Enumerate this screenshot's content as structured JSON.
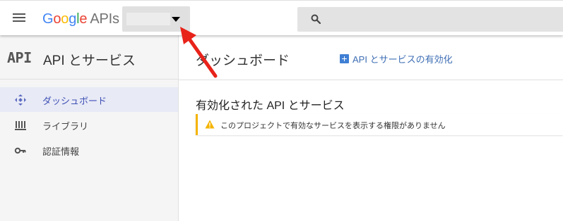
{
  "header": {
    "logo": {
      "letters": [
        "G",
        "o",
        "o",
        "g",
        "l",
        "e"
      ],
      "suffix": "APIs"
    },
    "brand_colors": [
      "#4285f4",
      "#ea4335",
      "#fbbc05",
      "#4285f4",
      "#34a853",
      "#ea4335"
    ],
    "menu_icon": "hamburger-menu-icon",
    "project_selector": {
      "selected_value": "",
      "caret_icon": "caret-down-icon"
    },
    "search": {
      "value": "",
      "placeholder": "",
      "icon": "search-icon"
    }
  },
  "sidebar": {
    "logo_text": "API",
    "title": "API とサービス",
    "items": [
      {
        "label": "ダッシュボード",
        "icon": "dashboard-icon",
        "active": true
      },
      {
        "label": "ライブラリ",
        "icon": "library-icon",
        "active": false
      },
      {
        "label": "認証情報",
        "icon": "key-icon",
        "active": false
      }
    ]
  },
  "main": {
    "title": "ダッシュボード",
    "enable_link": {
      "label": "API とサービスの有効化",
      "icon": "plus-box-icon"
    },
    "section_title": "有効化された API とサービス",
    "warning": {
      "icon": "warning-icon",
      "text": "このプロジェクトで有効なサービスを表示する権限がありません"
    }
  },
  "annotation": {
    "icon": "red-arrow-icon"
  },
  "colors": {
    "accent": "#3f51b5",
    "link": "#3f6fb5",
    "warning": "#f4b400",
    "sidebar_bg": "#f5f5f5",
    "active_bg": "#e8eaf6",
    "annotation_red": "#e8231a"
  }
}
